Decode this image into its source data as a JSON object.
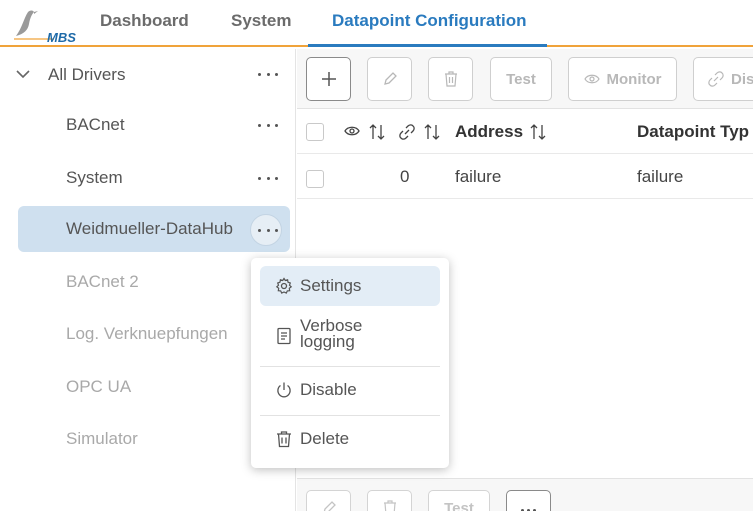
{
  "header": {
    "logo_text": "MBS",
    "tabs": [
      {
        "label": "Dashboard"
      },
      {
        "label": "System"
      },
      {
        "label": "Datapoint Configuration"
      }
    ]
  },
  "sidebar": {
    "root": {
      "label": "All Drivers"
    },
    "drivers": [
      {
        "label": "BACnet",
        "enabled": true
      },
      {
        "label": "System",
        "enabled": true
      },
      {
        "label": "Weidmueller-DataHub",
        "enabled": true,
        "selected": true
      },
      {
        "label": "BACnet 2",
        "enabled": false
      },
      {
        "label": "Log. Verknuepfungen",
        "enabled": false
      },
      {
        "label": "OPC UA",
        "enabled": false
      },
      {
        "label": "Simulator",
        "enabled": false
      }
    ]
  },
  "toolbar": {
    "add_label": "+",
    "test_label": "Test",
    "monitor_label": "Monitor",
    "disable_label": "Dis"
  },
  "table": {
    "columns": [
      {
        "label": ""
      },
      {
        "label": ""
      },
      {
        "label": "Address"
      },
      {
        "label": "Datapoint Typ"
      }
    ],
    "rows": [
      {
        "count": "0",
        "address": "failure",
        "type": "failure"
      }
    ]
  },
  "bottom_toolbar": {
    "test_label": "Test"
  },
  "context_menu": {
    "items": [
      {
        "label": "Settings",
        "icon": "gear-icon"
      },
      {
        "label": "Verbose",
        "label2": "logging",
        "icon": "document-icon"
      },
      {
        "label": "Disable",
        "icon": "power-icon"
      },
      {
        "label": "Delete",
        "icon": "trash-icon"
      }
    ]
  },
  "colors": {
    "accent": "#2a7bbf",
    "header_border": "#f0a33a",
    "selected_bg": "#cfe0ef"
  }
}
